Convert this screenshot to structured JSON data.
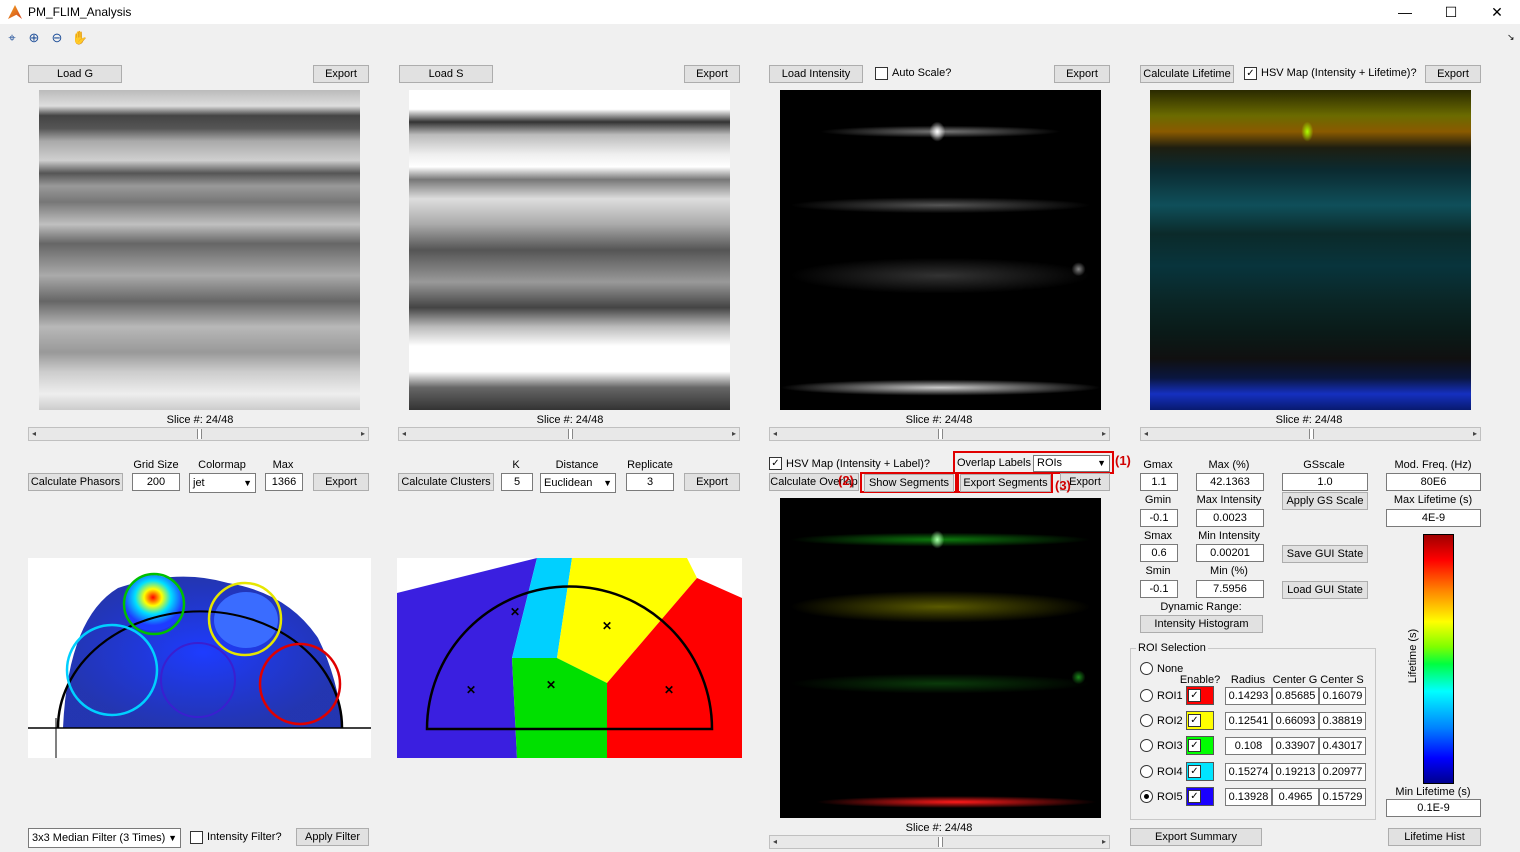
{
  "window": {
    "title": "PM_FLIM_Analysis",
    "minimize": "—",
    "maximize": "☐",
    "close": "✕"
  },
  "g_panel": {
    "load": "Load G",
    "export": "Export",
    "slice": "Slice #: 24/48"
  },
  "s_panel": {
    "load": "Load S",
    "export": "Export",
    "slice": "Slice #: 24/48"
  },
  "intensity_panel": {
    "load": "Load Intensity",
    "auto_scale": "Auto Scale?",
    "export": "Export",
    "slice": "Slice #: 24/48"
  },
  "lifetime_panel": {
    "calculate": "Calculate Lifetime",
    "hsv": "HSV Map (Intensity + Lifetime)?",
    "export": "Export",
    "slice": "Slice #: 24/48"
  },
  "phasor_controls": {
    "calculate": "Calculate Phasors",
    "grid_size_label": "Grid Size",
    "grid_size": "200",
    "colormap_label": "Colormap",
    "colormap": "jet",
    "max_label": "Max",
    "max": "1366",
    "export": "Export"
  },
  "cluster_controls": {
    "calculate": "Calculate Clusters",
    "k_label": "K",
    "k": "5",
    "distance_label": "Distance",
    "distance": "Euclidean",
    "replicate_label": "Replicate",
    "replicate": "3",
    "export": "Export"
  },
  "overlay_controls": {
    "hsv": "HSV Map (Intensity + Label)?",
    "overlap_label": "Overlap Labels",
    "overlap_value": "ROIs",
    "calculate": "Calculate Overlap",
    "show_segments": "Show Segments",
    "export_segments": "Export Segments",
    "export": "Export",
    "slice": "Slice #: 24/48",
    "annotations": [
      "(1)",
      "(2)",
      "(3)"
    ]
  },
  "settings": {
    "gmax_label": "Gmax",
    "gmax": "1.1",
    "gmin_label": "Gmin",
    "gmin": "-0.1",
    "smax_label": "Smax",
    "smax": "0.6",
    "smin_label": "Smin",
    "smin": "-0.1",
    "max_pct_label": "Max (%)",
    "max_pct": "42.1363",
    "max_int_label": "Max Intensity",
    "max_int": "0.0023",
    "min_int_label": "Min Intensity",
    "min_int": "0.00201",
    "min_pct_label": "Min (%)",
    "min_pct": "7.5956",
    "gsscale_label": "GSscale",
    "gsscale": "1.0",
    "apply_gs": "Apply GS Scale",
    "save_gui": "Save GUI State",
    "load_gui": "Load GUI State",
    "dynamic_range": "Dynamic Range:",
    "intensity_hist": "Intensity Histogram",
    "mod_freq_label": "Mod. Freq. (Hz)",
    "mod_freq": "80E6",
    "max_life_label": "Max Lifetime (s)",
    "max_life": "4E-9",
    "min_life_label": "Min Lifetime (s)",
    "min_life": "0.1E-9",
    "colorbar_label": "Lifetime (s)",
    "lifetime_hist": "Lifetime Hist",
    "export_summary": "Export Summary"
  },
  "roi": {
    "title": "ROI Selection",
    "none": "None",
    "headers": {
      "enable": "Enable?",
      "radius": "Radius",
      "cg": "Center G",
      "cs": "Center S"
    },
    "rows": [
      {
        "name": "ROI1",
        "color": "#ff0000",
        "radius": "0.14293",
        "cg": "0.85685",
        "cs": "0.16079",
        "selected": false
      },
      {
        "name": "ROI2",
        "color": "#ffff00",
        "radius": "0.12541",
        "cg": "0.66093",
        "cs": "0.38819",
        "selected": false
      },
      {
        "name": "ROI3",
        "color": "#00ff00",
        "radius": "0.108",
        "cg": "0.33907",
        "cs": "0.43017",
        "selected": false
      },
      {
        "name": "ROI4",
        "color": "#00e5ff",
        "radius": "0.15274",
        "cg": "0.19213",
        "cs": "0.20977",
        "selected": false
      },
      {
        "name": "ROI5",
        "color": "#1a00ff",
        "radius": "0.13928",
        "cg": "0.4965",
        "cs": "0.15729",
        "selected": true
      }
    ]
  },
  "filter_controls": {
    "filter": "3x3 Median Filter (3 Times)",
    "intensity_filter": "Intensity Filter?",
    "apply": "Apply Filter"
  }
}
